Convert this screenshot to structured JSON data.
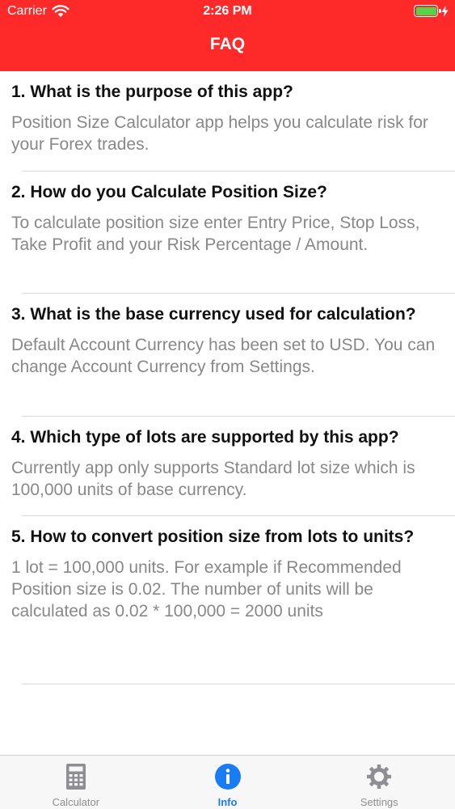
{
  "status_bar": {
    "carrier": "Carrier",
    "time": "2:26 PM",
    "battery_level": 1.0,
    "charging": true
  },
  "nav": {
    "title": "FAQ"
  },
  "faq": [
    {
      "question": "1. What is the purpose of this app?",
      "answer": "Position Size Calculator app helps you calculate risk for your Forex trades."
    },
    {
      "question": "2. How do you Calculate Position Size?",
      "answer": "To calculate position size enter Entry Price, Stop Loss, Take Profit and your Risk Percentage / Amount."
    },
    {
      "question": "3. What is the base currency used for calculation?",
      "answer": "Default Account Currency has been set to USD. You can change Account Currency from Settings."
    },
    {
      "question": "4. Which type of lots are supported by this app?",
      "answer": "Currently app only supports Standard lot size which is 100,000 units of base currency."
    },
    {
      "question": "5. How to convert position size from lots to units?",
      "answer": "1 lot = 100,000 units. For example if Recommended Position size is 0.02. The number of units will be calculated as 0.02 * 100,000 = 2000 units"
    }
  ],
  "tabs": [
    {
      "label": "Calculator",
      "icon": "calculator-icon",
      "active": false
    },
    {
      "label": "Info",
      "icon": "info-icon",
      "active": true
    },
    {
      "label": "Settings",
      "icon": "gear-icon",
      "active": false
    }
  ],
  "colors": {
    "header": "#fe2a2a",
    "tab_active": "#1a7cf5",
    "tab_inactive": "#8e8e93",
    "answer_text": "#888888",
    "battery": "#56d34a"
  }
}
